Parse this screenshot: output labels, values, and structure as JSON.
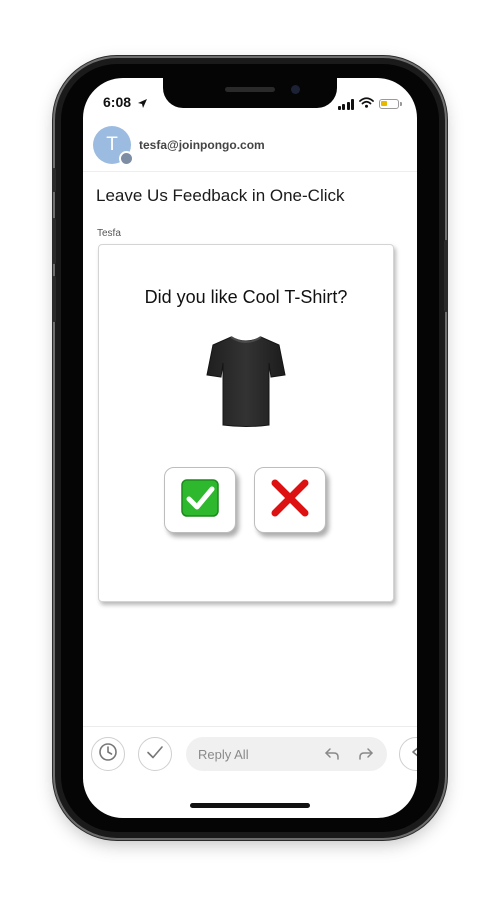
{
  "status_bar": {
    "time": "6:08"
  },
  "email": {
    "avatar_initial": "T",
    "sender_email": "tesfa@joinpongo.com",
    "subject": "Leave Us Feedback in One-Click",
    "from_name": "Tesfa"
  },
  "feedback_card": {
    "question": "Did you like Cool T-Shirt?",
    "product_image": "black-tshirt",
    "yes_icon": "green-check-mark-icon",
    "no_icon": "red-cross-mark-icon"
  },
  "toolbar": {
    "reply_placeholder": "Reply All",
    "icons": [
      "clock-icon",
      "checkmark-icon",
      "reply-icon",
      "forward-icon",
      "more-icon"
    ]
  },
  "colors": {
    "avatar": "#9bbbe0",
    "check_green": "#2db82d",
    "cross_red": "#dd1111",
    "battery": "#e8b700"
  }
}
